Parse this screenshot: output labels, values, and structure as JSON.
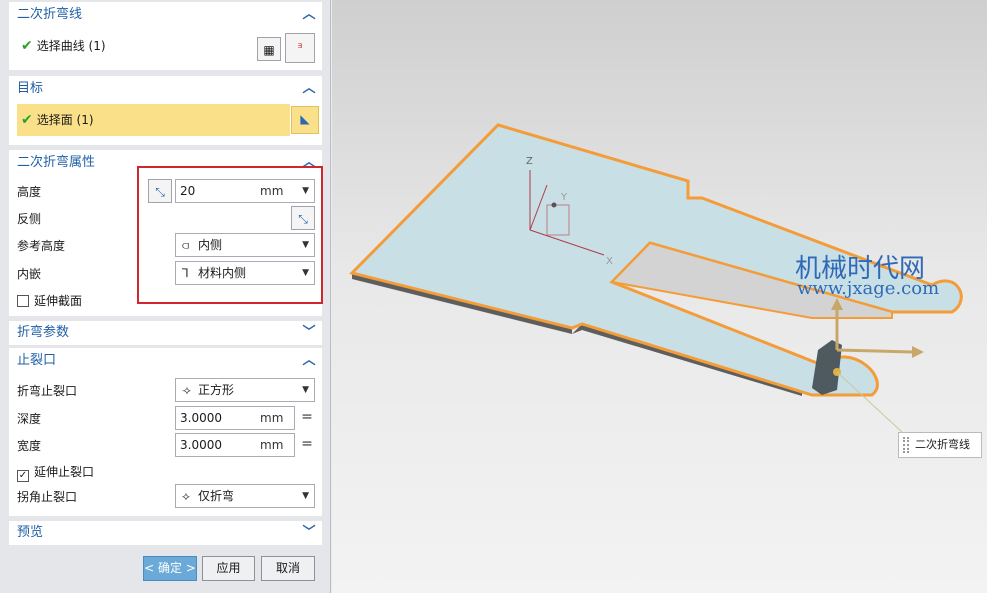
{
  "sections": {
    "secondary_bend_line": {
      "title": "二次折弯线",
      "select_curve_label": "选择曲线 (1)"
    },
    "target": {
      "title": "目标",
      "select_face_label": "选择面 (1)"
    },
    "properties": {
      "title": "二次折弯属性",
      "height_label": "高度",
      "height_value": "20",
      "height_unit": "mm",
      "reverse_side_label": "反侧",
      "ref_height_label": "参考高度",
      "ref_height_value": "内侧",
      "inset_label": "内嵌",
      "inset_value": "材料内侧",
      "extend_section_label": "延伸截面"
    },
    "bend_params": {
      "title": "折弯参数"
    },
    "relief": {
      "title": "止裂口",
      "bend_relief_label": "折弯止裂口",
      "bend_relief_value": "正方形",
      "depth_label": "深度",
      "depth_value": "3.0000",
      "depth_unit": "mm",
      "width_label": "宽度",
      "width_value": "3.0000",
      "width_unit": "mm",
      "extend_relief_label": "延伸止裂口",
      "corner_relief_label": "拐角止裂口",
      "corner_relief_value": "仅折弯"
    },
    "preview": {
      "title": "预览"
    }
  },
  "buttons": {
    "ok": "< 确定 >",
    "apply": "应用",
    "cancel": "取消"
  },
  "viewport": {
    "callout_label": "二次折弯线",
    "axis_z": "Z",
    "axis_y": "Y",
    "axis_x": "X",
    "watermark_cn": "机械时代网",
    "watermark_url": "www.jxage.com"
  },
  "colors": {
    "accent": "#1f5fa6",
    "selection_highlight": "#fbe08a",
    "edge_highlight": "#f39c38",
    "red_box": "#d0262e",
    "sheet_face": "#c9dfe6"
  }
}
